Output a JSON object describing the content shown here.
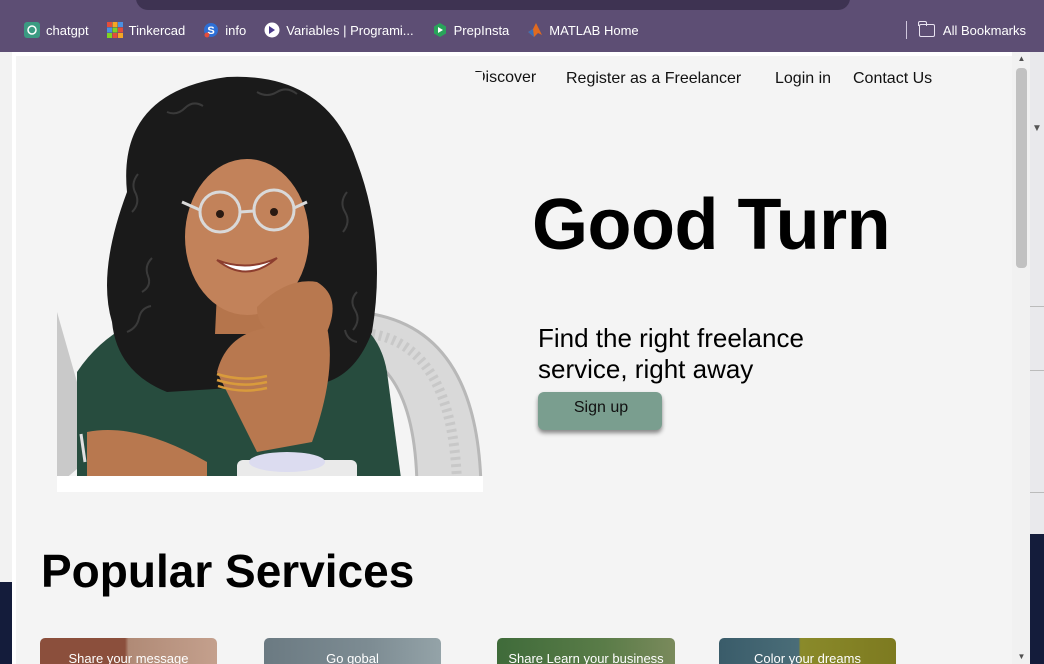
{
  "bookmarks_bar": {
    "items": [
      {
        "label": "chatgpt",
        "icon": "chatgpt-icon",
        "color": "#3b9a82"
      },
      {
        "label": "Tinkercad",
        "icon": "tinkercad-icon",
        "color": "#e44d3a"
      },
      {
        "label": "info",
        "icon": "info-s-icon",
        "color": "#2d6fd6"
      },
      {
        "label": "Variables | Programi...",
        "icon": "variables-icon",
        "color": "#ffffff"
      },
      {
        "label": "PrepInsta",
        "icon": "prepinsta-icon",
        "color": "#29a35a"
      },
      {
        "label": "MATLAB Home",
        "icon": "matlab-icon",
        "color": "#e16a1f"
      }
    ],
    "all_bookmarks": "All Bookmarks"
  },
  "nav": {
    "discover": "Discover",
    "register": "Register as a Freelancer",
    "login": "Login in",
    "contact": "Contact Us"
  },
  "hero": {
    "brand": "Good Turn",
    "tagline": "Find the right freelance service, right away",
    "signup_label": "Sign up"
  },
  "services": {
    "heading": "Popular Services",
    "cards": [
      {
        "label": "Share your message"
      },
      {
        "label": "Go gobal"
      },
      {
        "label": "Share Learn your business"
      },
      {
        "label": "Color your dreams"
      }
    ]
  },
  "colors": {
    "chrome": "#5d4e74",
    "page_bg": "#f4f4f4",
    "signup_button": "#7a9e8f"
  }
}
